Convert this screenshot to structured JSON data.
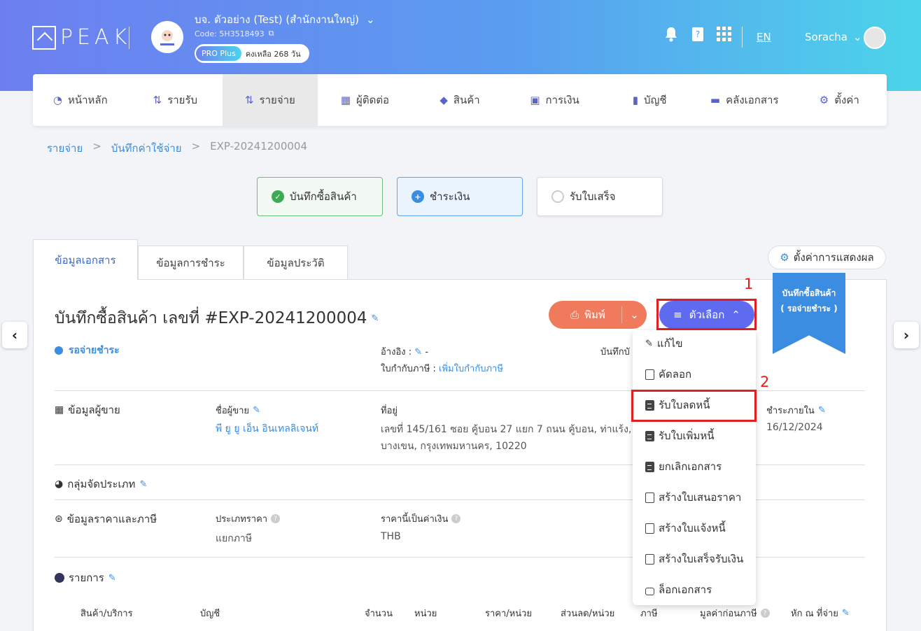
{
  "header": {
    "logo_text": "PEAK",
    "company_name": "บจ. ตัวอย่าง (Test) (สำนักงานใหญ่)",
    "company_code": "Code: 5H3518493",
    "plan_badge": "PRO Plus",
    "plan_remaining": "คงเหลือ 268 วัน",
    "language": "EN",
    "user_name": "Soracha",
    "icons": [
      "bell-icon",
      "help-book-icon",
      "apps-grid-icon"
    ]
  },
  "nav": {
    "items": [
      {
        "label": "หน้าหลัก",
        "icon": "dashboard-icon"
      },
      {
        "label": "รายรับ",
        "icon": "income-icon"
      },
      {
        "label": "รายจ่าย",
        "icon": "expense-icon",
        "active": true
      },
      {
        "label": "ผู้ติดต่อ",
        "icon": "contacts-icon"
      },
      {
        "label": "สินค้า",
        "icon": "box-icon"
      },
      {
        "label": "การเงิน",
        "icon": "money-icon"
      },
      {
        "label": "บัญชี",
        "icon": "ledger-icon"
      },
      {
        "label": "คลังเอกสาร",
        "icon": "folder-icon"
      },
      {
        "label": "ตั้งค่า",
        "icon": "gear-icon"
      }
    ]
  },
  "breadcrumb": {
    "items": [
      "รายจ่าย",
      "บันทึกค่าใช้จ่าย",
      "EXP-20241200004"
    ],
    "separator": ">"
  },
  "steps": [
    {
      "label": "บันทึกซื้อสินค้า",
      "state": "done"
    },
    {
      "label": "ชำระเงิน",
      "state": "current"
    },
    {
      "label": "รับใบเสร็จ",
      "state": "pending"
    }
  ],
  "tabs": [
    "ข้อมูลเอกสาร",
    "ข้อมูลการชำระ",
    "ข้อมูลประวัติ"
  ],
  "display_setting_label": "ตั้งค่าการแสดงผล",
  "document": {
    "title": "บันทึกซื้อสินค้า เลขที่ #EXP-20241200004",
    "print_label": "พิมพ์",
    "options_label": "ตัวเลือก",
    "ribbon_line1": "บันทึกซื้อสินค้า",
    "ribbon_line2": "( รอจ่ายชำระ )",
    "status": "รอจ่ายชำระ",
    "reference_label": "อ้างอิง :",
    "reference_value": "-",
    "tax_invoice_label": "ใบกำกับภาษี :",
    "tax_invoice_link": "เพิ่มใบกำกับภาษี",
    "record_label_partial": "บันทึกบั"
  },
  "annotations": {
    "marker1": "1",
    "marker2": "2"
  },
  "dropdown": {
    "items": [
      {
        "label": "แก้ไข",
        "icon": "edit-icon"
      },
      {
        "label": "คัดลอก",
        "icon": "copy-icon"
      },
      {
        "label": "รับใบลดหนี้",
        "icon": "document-icon",
        "highlighted": true
      },
      {
        "label": "รับใบเพิ่มหนี้",
        "icon": "document-icon"
      },
      {
        "label": "ยกเลิกเอกสาร",
        "icon": "cancel-doc-icon"
      },
      {
        "label": "สร้างใบเสนอราคา",
        "icon": "copy-icon"
      },
      {
        "label": "สร้างใบแจ้งหนี้",
        "icon": "copy-icon"
      },
      {
        "label": "สร้างใบเสร็จรับเงิน",
        "icon": "copy-icon"
      },
      {
        "label": "ล็อกเอกสาร",
        "icon": "lock-icon"
      }
    ]
  },
  "vendor": {
    "section_label": "ข้อมูลผู้ขาย",
    "name_label": "ชื่อผู้ขาย",
    "name_value": "พี ยู ยู เอ็น อินเทลลิเจนท์",
    "address_label": "ที่อยู่",
    "address_line1": "เลขที่ 145/161 ซอย คู้บอน 27 แยก 7 ถนน คู้บอน, ท่าแร้ง,",
    "address_line2": "บางเขน, กรุงเทพมหานคร, 10220",
    "due_label": "ชำระภายใน",
    "due_value": "16/12/2024"
  },
  "category": {
    "section_label": "กลุ่มจัดประเภท"
  },
  "pricing": {
    "section_label": "ข้อมูลราคาและภาษี",
    "price_type_label": "ประเภทราคา",
    "price_type_value": "แยกภาษี",
    "currency_label": "ราคานี้เป็นค่าเงิน",
    "currency_value": "THB"
  },
  "items_section": {
    "section_label": "รายการ",
    "columns": [
      "สินค้า/บริการ",
      "บัญชี",
      "จำนวน",
      "หน่วย",
      "ราคา/หน่วย",
      "ส่วนลด/หน่วย",
      "ภาษี",
      "มูลค่าก่อนภาษี",
      "หัก ณ ที่จ่าย"
    ]
  },
  "colors": {
    "accent": "#5e6af0",
    "link": "#3a8de0",
    "print": "#f07a5c",
    "annotation": "#e02020"
  }
}
